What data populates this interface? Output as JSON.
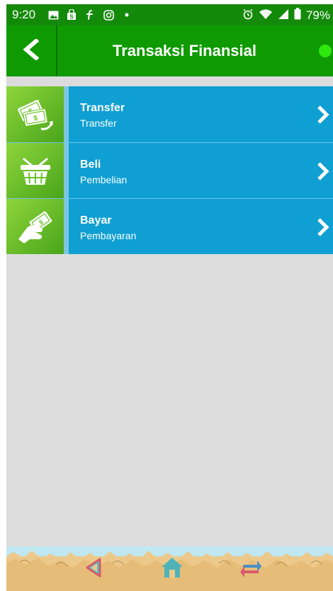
{
  "status_bar": {
    "time": "9:20",
    "battery": "79%",
    "left_icons": [
      "image-icon",
      "shop-bag-icon",
      "f-icon",
      "instagram-icon",
      "dot-icon"
    ],
    "right_icons": [
      "alarm-icon",
      "wifi-icon",
      "signal-icon",
      "battery-icon"
    ]
  },
  "header": {
    "title": "Transaksi Finansial",
    "status_color": "#2ee80e"
  },
  "menu": {
    "items": [
      {
        "title": "Transfer",
        "subtitle": "Transfer",
        "icon": "money-transfer-icon"
      },
      {
        "title": "Beli",
        "subtitle": "Pembelian",
        "icon": "shopping-basket-icon"
      },
      {
        "title": "Bayar",
        "subtitle": "Pembayaran",
        "icon": "hand-money-icon"
      }
    ]
  },
  "colors": {
    "appbar": "#0f9a02",
    "item_body": "#0f9fd2",
    "icon_tile": "#6cc22a",
    "background": "#dcdcdc"
  },
  "footer_nav": {
    "buttons": [
      "back-triangle-icon",
      "home-icon",
      "exchange-arrows-icon"
    ]
  }
}
